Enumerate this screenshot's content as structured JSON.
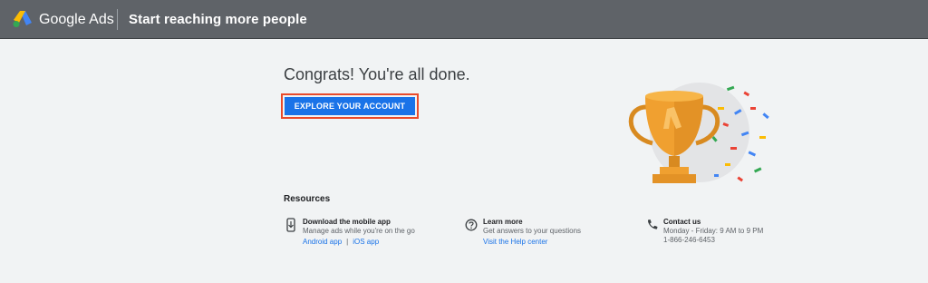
{
  "header": {
    "brand": "Google Ads",
    "page_title": "Start reaching more people"
  },
  "main": {
    "headline": "Congrats! You're all done.",
    "cta_label": "EXPLORE YOUR ACCOUNT"
  },
  "resources": {
    "title": "Resources",
    "mobile": {
      "title": "Download the mobile app",
      "desc": "Manage ads while you're on the go",
      "android": "Android app",
      "separator": "|",
      "ios": "iOS app"
    },
    "learn": {
      "title": "Learn more",
      "desc": "Get answers to your questions",
      "link": "Visit the Help center"
    },
    "contact": {
      "title": "Contact us",
      "hours": "Monday - Friday: 9 AM to 9 PM",
      "phone": "1-866-246-6453"
    }
  },
  "icons": {
    "logo": "google-ads-logo",
    "mobile": "phone-download-icon",
    "learn": "help-circle-icon",
    "contact": "phone-icon"
  },
  "colors": {
    "header_bg": "#5f6368",
    "page_bg": "#f1f3f4",
    "primary": "#1a73e8",
    "focus_outline": "#ea4a2a",
    "trophy": "#f0a030"
  }
}
